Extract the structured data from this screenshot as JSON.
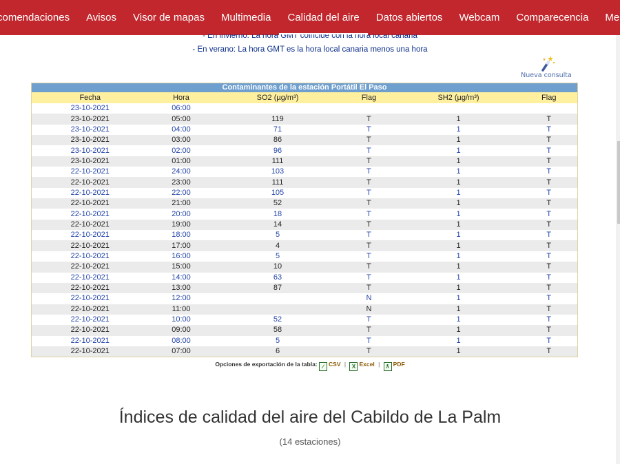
{
  "nav": {
    "items": [
      {
        "label": "comendaciones",
        "active": false
      },
      {
        "label": "Avisos",
        "active": false
      },
      {
        "label": "Visor de mapas",
        "active": false
      },
      {
        "label": "Multimedia",
        "active": false
      },
      {
        "label": "Calidad del aire",
        "active": true
      },
      {
        "label": "Datos abiertos",
        "active": false
      },
      {
        "label": "Webcam",
        "active": false
      },
      {
        "label": "Comparecencia",
        "active": false
      },
      {
        "label": "Mehr",
        "active": false
      }
    ]
  },
  "notes": {
    "winter": "- En invierno: La hora GMT coincide con la hora local canaria",
    "summer": "- En verano: La hora GMT es la hora local canaria menos una hora"
  },
  "nueva_consulta": {
    "label": "Nueva consulta",
    "icon": "magic-wand-icon"
  },
  "table": {
    "caption": "Contaminantes de la estación Portátil El Paso",
    "headers": [
      "Fecha",
      "Hora",
      "SO2 (µg/m³)",
      "Flag",
      "SH2 (µg/m³)",
      "Flag"
    ],
    "rows": [
      [
        "23-10-2021",
        "06:00",
        "",
        "",
        "",
        ""
      ],
      [
        "23-10-2021",
        "05:00",
        "119",
        "T",
        "1",
        "T"
      ],
      [
        "23-10-2021",
        "04:00",
        "71",
        "T",
        "1",
        "T"
      ],
      [
        "23-10-2021",
        "03:00",
        "86",
        "T",
        "1",
        "T"
      ],
      [
        "23-10-2021",
        "02:00",
        "96",
        "T",
        "1",
        "T"
      ],
      [
        "23-10-2021",
        "01:00",
        "111",
        "T",
        "1",
        "T"
      ],
      [
        "22-10-2021",
        "24:00",
        "103",
        "T",
        "1",
        "T"
      ],
      [
        "22-10-2021",
        "23:00",
        "111",
        "T",
        "1",
        "T"
      ],
      [
        "22-10-2021",
        "22:00",
        "105",
        "T",
        "1",
        "T"
      ],
      [
        "22-10-2021",
        "21:00",
        "52",
        "T",
        "1",
        "T"
      ],
      [
        "22-10-2021",
        "20:00",
        "18",
        "T",
        "1",
        "T"
      ],
      [
        "22-10-2021",
        "19:00",
        "14",
        "T",
        "1",
        "T"
      ],
      [
        "22-10-2021",
        "18:00",
        "5",
        "T",
        "1",
        "T"
      ],
      [
        "22-10-2021",
        "17:00",
        "4",
        "T",
        "1",
        "T"
      ],
      [
        "22-10-2021",
        "16:00",
        "5",
        "T",
        "1",
        "T"
      ],
      [
        "22-10-2021",
        "15:00",
        "10",
        "T",
        "1",
        "T"
      ],
      [
        "22-10-2021",
        "14:00",
        "63",
        "T",
        "1",
        "T"
      ],
      [
        "22-10-2021",
        "13:00",
        "87",
        "T",
        "1",
        "T"
      ],
      [
        "22-10-2021",
        "12:00",
        "",
        "N",
        "1",
        "T"
      ],
      [
        "22-10-2021",
        "11:00",
        "",
        "N",
        "1",
        "T"
      ],
      [
        "22-10-2021",
        "10:00",
        "52",
        "T",
        "1",
        "T"
      ],
      [
        "22-10-2021",
        "09:00",
        "58",
        "T",
        "1",
        "T"
      ],
      [
        "22-10-2021",
        "08:00",
        "5",
        "T",
        "1",
        "T"
      ],
      [
        "22-10-2021",
        "07:00",
        "6",
        "T",
        "1",
        "T"
      ]
    ]
  },
  "export": {
    "label": "Opciones de exportación de la tabla:",
    "csv": "CSV",
    "excel": "Excel",
    "pdf": "PDF",
    "separator": "|"
  },
  "section": {
    "title": "Índices de calidad del aire del Cabildo de La Palm",
    "subtitle": "(14 estaciones)"
  },
  "colors": {
    "nav_bg": "#c1272d",
    "caption_bg": "#6f9fcf",
    "header_bg": "#fff0a0",
    "link_blue": "#2244aa"
  }
}
